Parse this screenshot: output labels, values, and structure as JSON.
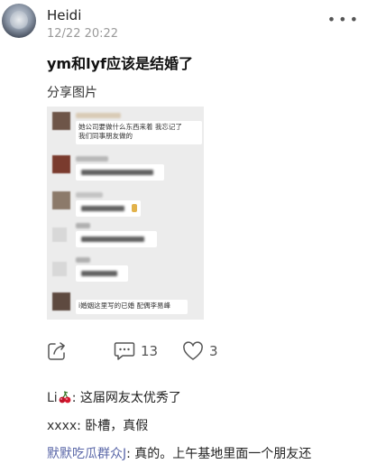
{
  "post": {
    "username": "Heidi",
    "timestamp": "12/22 20:22",
    "more": "•••",
    "title": "ym和lyf应该是结婚了",
    "share_label": "分享图片"
  },
  "shared_image": {
    "bubble1_line1": "她公司要做什么东西来着 我忘记了 ",
    "bubble1_line2": "我们同事朋友做的",
    "bubble_last": "i婚姻这里写的已婚 配偶李易峰"
  },
  "actions": {
    "comment_count": "13",
    "like_count": "3"
  },
  "comments": [
    {
      "name": "Li",
      "text": ": 这届网友太优秀了"
    },
    {
      "name": "xxxx",
      "text": ": 卧槽，真假"
    },
    {
      "name": "默默吃瓜群众J",
      "text": ": 真的。上午基地里面一个朋友还"
    }
  ],
  "colors": {
    "name_link": "#5a67a8",
    "icon": "#555555"
  },
  "icons": [
    "share-icon",
    "comment-icon",
    "like-icon",
    "cherry-emoji-icon",
    "more-icon"
  ]
}
